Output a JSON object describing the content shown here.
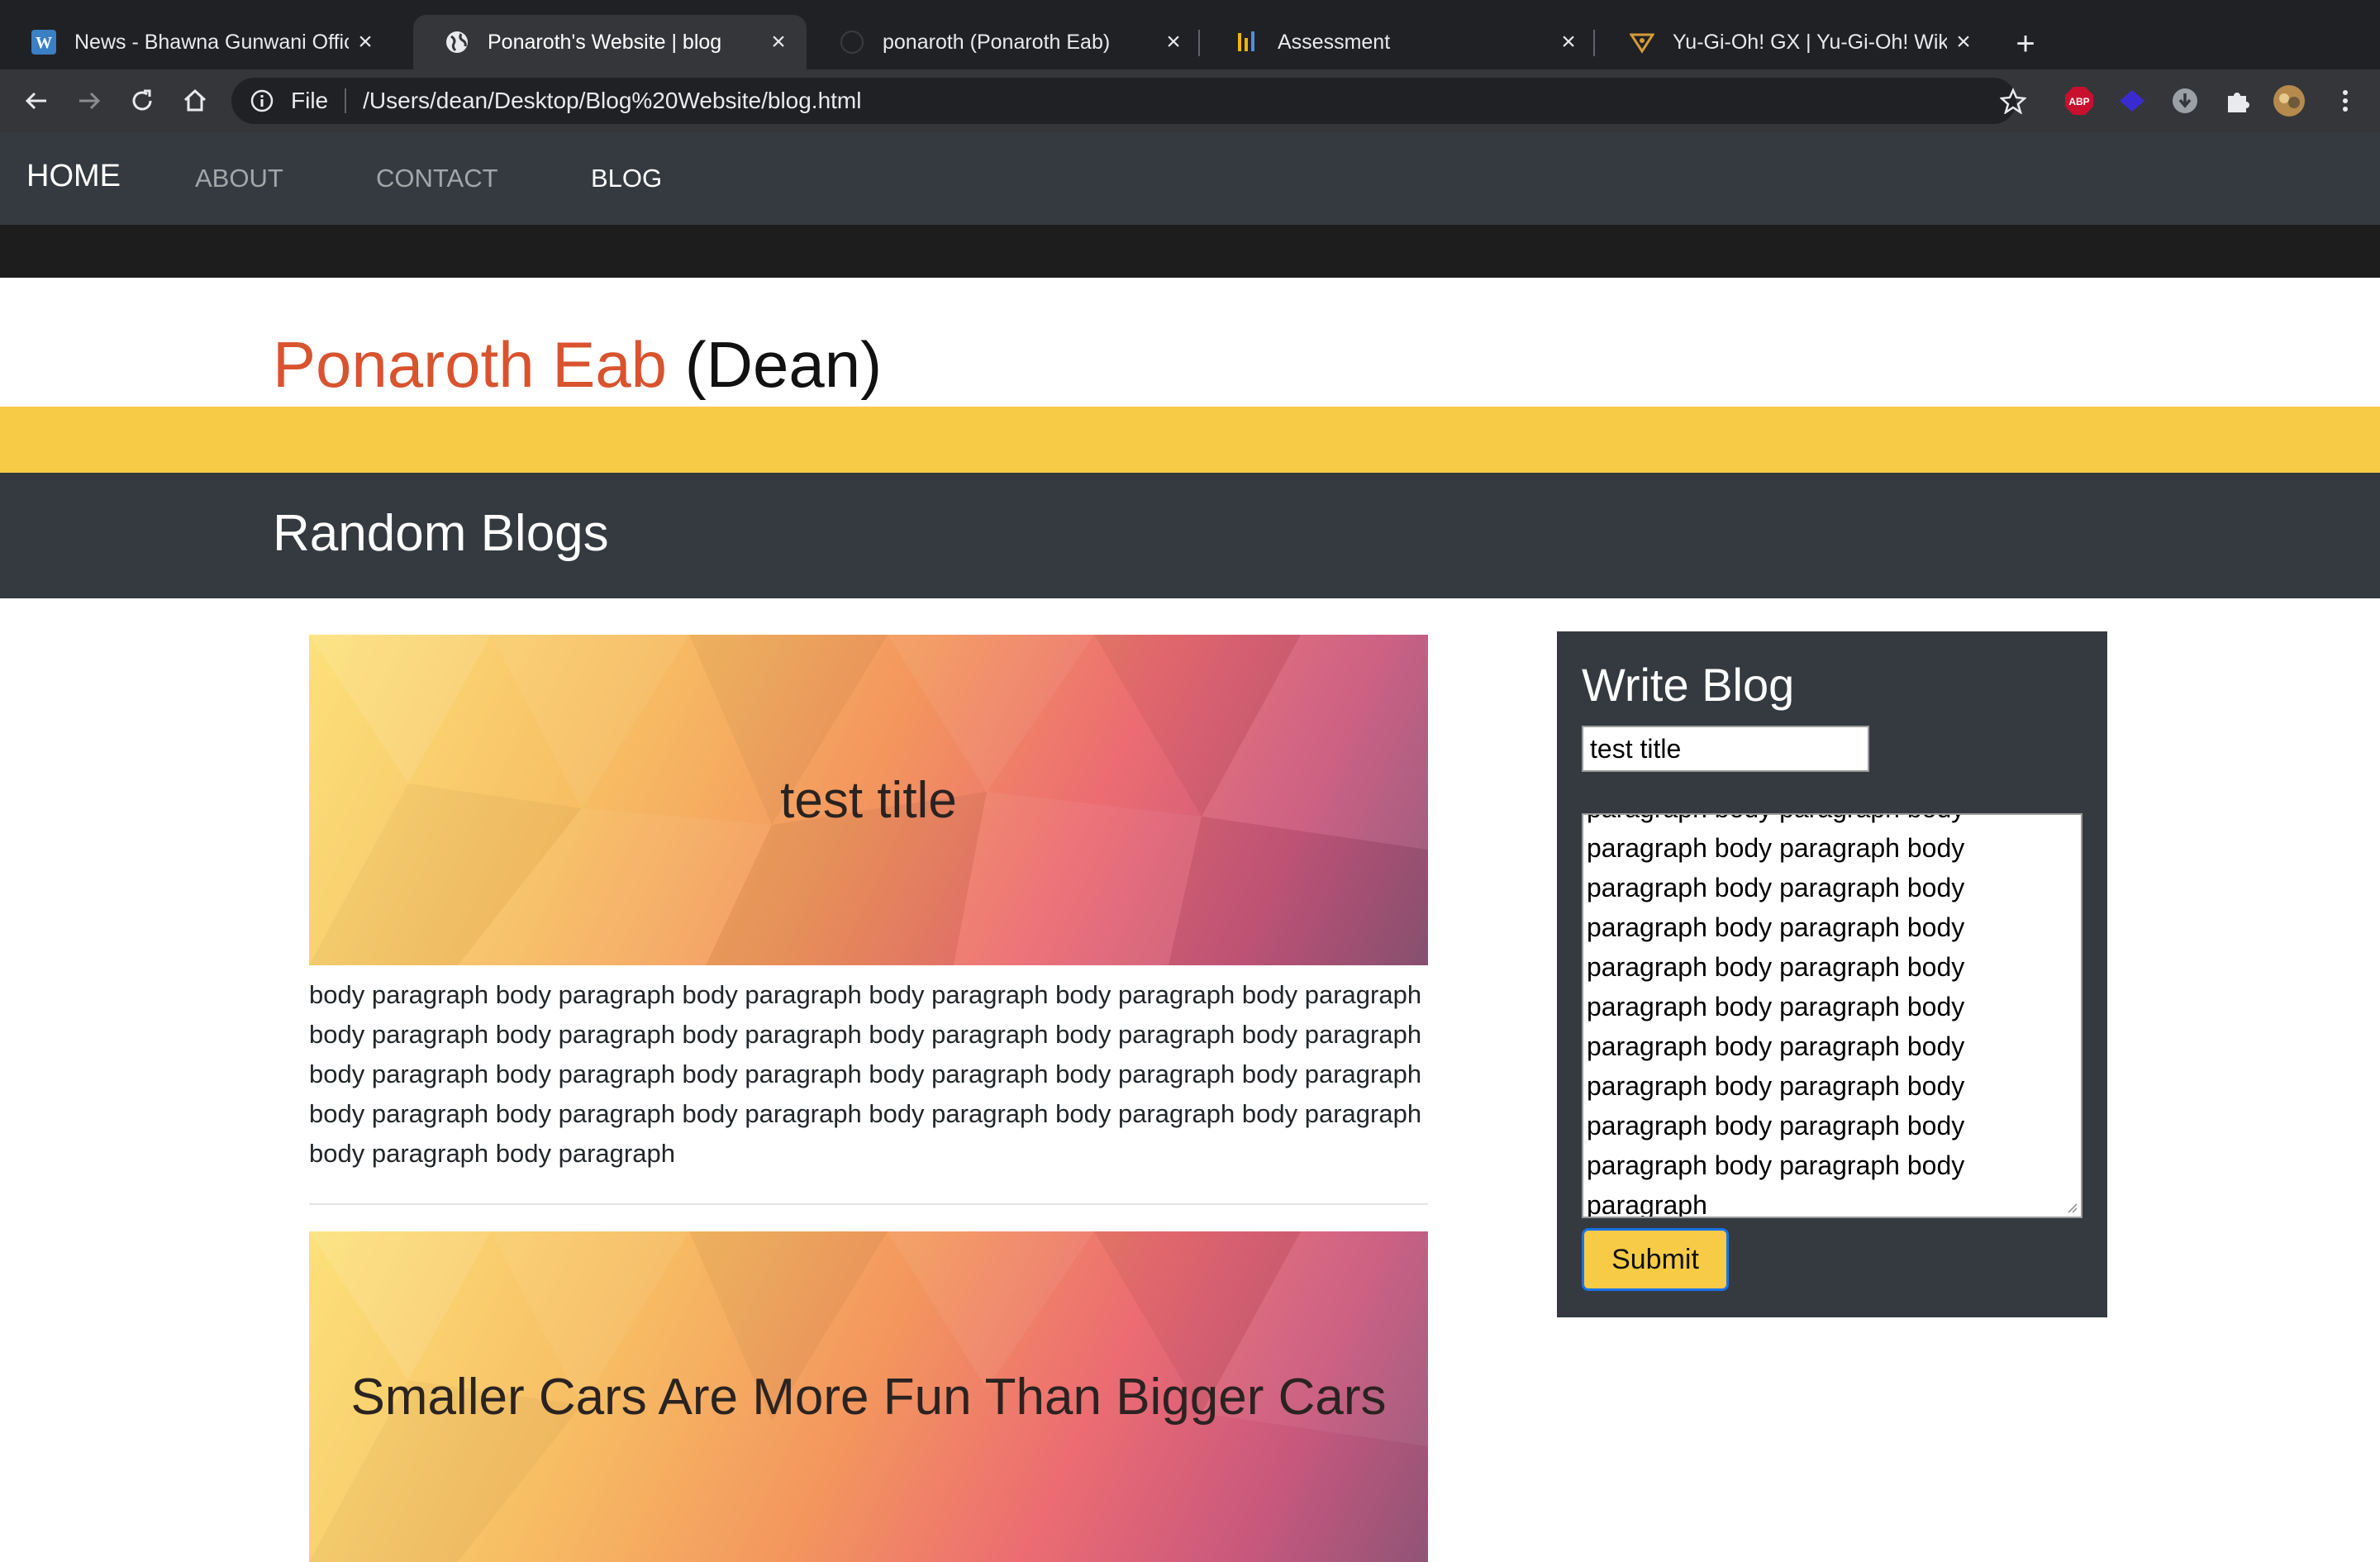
{
  "browser": {
    "tabs": [
      {
        "title": "News - Bhawna Gunwani Offici",
        "icon": "wordpress-icon"
      },
      {
        "title": "Ponaroth's Website | blog",
        "icon": "globe-icon"
      },
      {
        "title": "ponaroth (Ponaroth Eab)",
        "icon": "github-icon"
      },
      {
        "title": "Assessment",
        "icon": "assessment-icon"
      },
      {
        "title": "Yu-Gi-Oh! GX | Yu-Gi-Oh! Wiki",
        "icon": "yugioh-icon"
      }
    ],
    "active_tab": 1,
    "address": {
      "scheme": "File",
      "url": "/Users/dean/Desktop/Blog%20Website/blog.html"
    },
    "extensions": [
      "adblock-plus-icon",
      "diamond-extension-icon",
      "download-extension-icon",
      "puzzle-extensions-icon",
      "profile-avatar"
    ],
    "extension_badge": "ABP"
  },
  "nav": {
    "brand": "HOME",
    "links": [
      {
        "label": "ABOUT",
        "active": false
      },
      {
        "label": "CONTACT",
        "active": false
      },
      {
        "label": "BLOG",
        "active": true
      }
    ]
  },
  "header": {
    "first_name": "Ponaroth Eab",
    "nickname": "(Dean)",
    "accent": "#d9532f"
  },
  "section": {
    "title": "Random Blogs"
  },
  "posts": [
    {
      "title": "test title",
      "body": "body paragraph body paragraph body paragraph body paragraph body paragraph body paragraph body paragraph body paragraph body paragraph body paragraph body paragraph body paragraph body paragraph body paragraph body paragraph body paragraph body paragraph body paragraph body paragraph body paragraph body paragraph body paragraph body paragraph body paragraph body paragraph body paragraph"
    },
    {
      "title": "Smaller Cars Are More Fun Than Bigger Cars"
    }
  ],
  "write_blog": {
    "heading": "Write Blog",
    "title_value": "test title",
    "body_lines": [
      "paragraph body paragraph body",
      "paragraph body paragraph body",
      "paragraph body paragraph body",
      "paragraph body paragraph body",
      "paragraph body paragraph body",
      "paragraph body paragraph body",
      "paragraph body paragraph body",
      "paragraph body paragraph body",
      "paragraph body paragraph body",
      "paragraph body paragraph body",
      "paragraph"
    ],
    "submit_label": "Submit"
  },
  "colors": {
    "navbar": "#343a40",
    "yellow": "#f8cb46",
    "focus": "#1a73e8"
  }
}
